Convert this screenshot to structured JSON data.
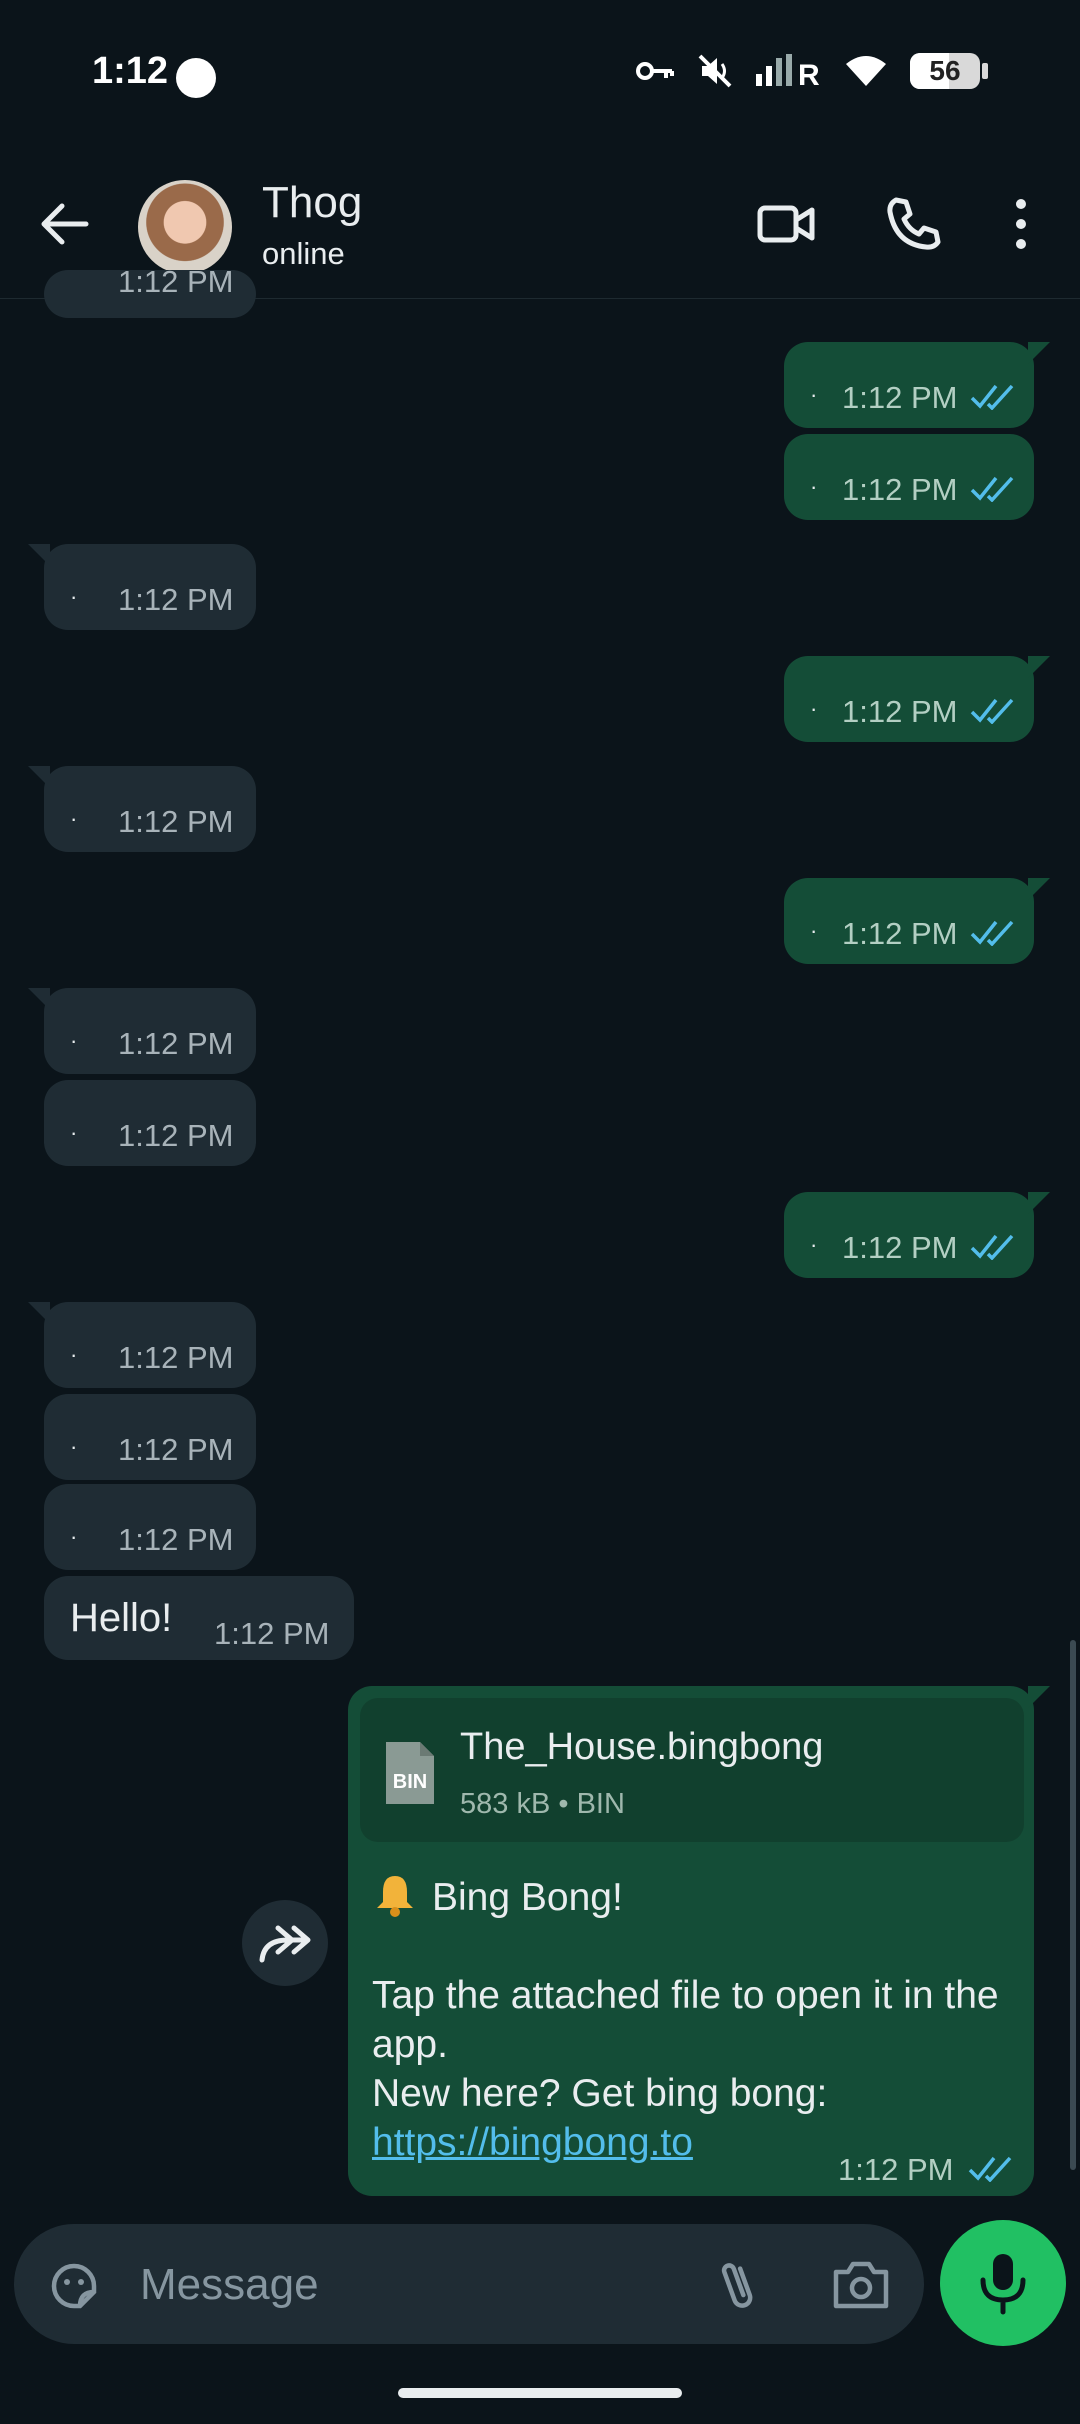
{
  "status_bar": {
    "time": "1:12",
    "battery": "56"
  },
  "header": {
    "contact_name": "Thog",
    "contact_status": "online"
  },
  "messages": {
    "partial_top_time": "1:12 PM",
    "o1": {
      "dot": "·",
      "time": "1:12 PM"
    },
    "o2": {
      "dot": "·",
      "time": "1:12 PM"
    },
    "i1": {
      "dot": "·",
      "time": "1:12 PM"
    },
    "o3": {
      "dot": "·",
      "time": "1:12 PM"
    },
    "i2": {
      "dot": "·",
      "time": "1:12 PM"
    },
    "o4": {
      "dot": "·",
      "time": "1:12 PM"
    },
    "i3": {
      "dot": "·",
      "time": "1:12 PM"
    },
    "i4": {
      "dot": "·",
      "time": "1:12 PM"
    },
    "o5": {
      "dot": "·",
      "time": "1:12 PM"
    },
    "i5": {
      "dot": "·",
      "time": "1:12 PM"
    },
    "i6": {
      "dot": "·",
      "time": "1:12 PM"
    },
    "i7": {
      "dot": "·",
      "time": "1:12 PM"
    },
    "hello": {
      "text": "Hello!",
      "time": "1:12 PM"
    },
    "bingbong": {
      "file_name": "The_House.bingbong",
      "file_size": "583 kB",
      "file_sep": "•",
      "file_type": "BIN",
      "file_icon_label": "BIN",
      "line1": "Bing Bong!",
      "line2": "Tap the attached file to open it in the app.",
      "line3": "New here? Get bing bong:",
      "link": "https://bingbong.to",
      "time": "1:12 PM"
    }
  },
  "composer": {
    "placeholder": "Message"
  },
  "colors": {
    "bg": "#0b141a",
    "incoming": "#1f2c34",
    "outgoing": "#144d37",
    "tick": "#53bdeb",
    "mic": "#21c063"
  }
}
